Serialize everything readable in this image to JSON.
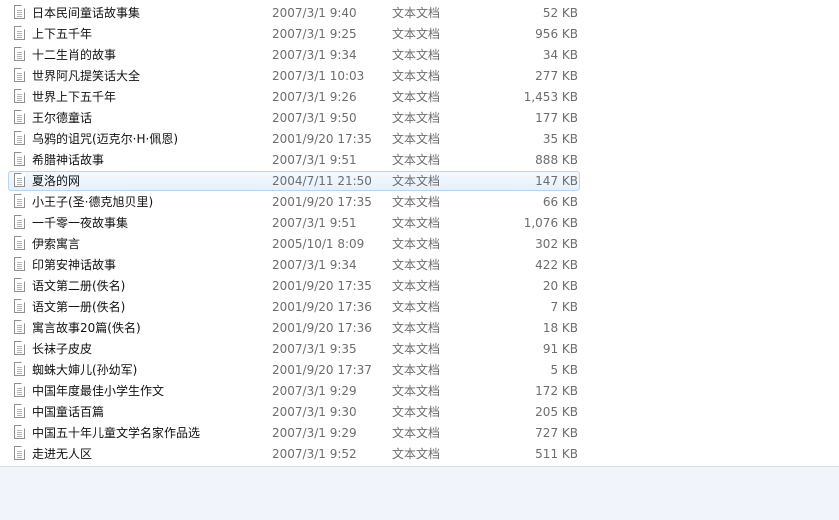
{
  "files": [
    {
      "name": "日本民间童话故事集",
      "date": "2007/3/1 9:40",
      "type": "文本文档",
      "size": "52 KB"
    },
    {
      "name": "上下五千年",
      "date": "2007/3/1 9:25",
      "type": "文本文档",
      "size": "956 KB"
    },
    {
      "name": "十二生肖的故事",
      "date": "2007/3/1 9:34",
      "type": "文本文档",
      "size": "34 KB"
    },
    {
      "name": "世界阿凡提笑话大全",
      "date": "2007/3/1 10:03",
      "type": "文本文档",
      "size": "277 KB"
    },
    {
      "name": "世界上下五千年",
      "date": "2007/3/1 9:26",
      "type": "文本文档",
      "size": "1,453 KB"
    },
    {
      "name": "王尔德童话",
      "date": "2007/3/1 9:50",
      "type": "文本文档",
      "size": "177 KB"
    },
    {
      "name": "乌鸦的诅咒(迈克尔·H·佩恩)",
      "date": "2001/9/20 17:35",
      "type": "文本文档",
      "size": "35 KB"
    },
    {
      "name": "希腊神话故事",
      "date": "2007/3/1 9:51",
      "type": "文本文档",
      "size": "888 KB"
    },
    {
      "name": "夏洛的网",
      "date": "2004/7/11 21:50",
      "type": "文本文档",
      "size": "147 KB",
      "selected": true
    },
    {
      "name": "小王子(圣·德克旭贝里)",
      "date": "2001/9/20 17:35",
      "type": "文本文档",
      "size": "66 KB"
    },
    {
      "name": "一千零一夜故事集",
      "date": "2007/3/1 9:51",
      "type": "文本文档",
      "size": "1,076 KB"
    },
    {
      "name": "伊索寓言",
      "date": "2005/10/1 8:09",
      "type": "文本文档",
      "size": "302 KB"
    },
    {
      "name": "印第安神话故事",
      "date": "2007/3/1 9:34",
      "type": "文本文档",
      "size": "422 KB"
    },
    {
      "name": "语文第二册(佚名)",
      "date": "2001/9/20 17:35",
      "type": "文本文档",
      "size": "20 KB"
    },
    {
      "name": "语文第一册(佚名)",
      "date": "2001/9/20 17:36",
      "type": "文本文档",
      "size": "7 KB"
    },
    {
      "name": "寓言故事20篇(佚名)",
      "date": "2001/9/20 17:36",
      "type": "文本文档",
      "size": "18 KB"
    },
    {
      "name": "长袜子皮皮",
      "date": "2007/3/1 9:35",
      "type": "文本文档",
      "size": "91 KB"
    },
    {
      "name": "蜘蛛大婶儿(孙幼军)",
      "date": "2001/9/20 17:37",
      "type": "文本文档",
      "size": "5 KB"
    },
    {
      "name": "中国年度最佳小学生作文",
      "date": "2007/3/1 9:29",
      "type": "文本文档",
      "size": "172 KB"
    },
    {
      "name": "中国童话百篇",
      "date": "2007/3/1 9:30",
      "type": "文本文档",
      "size": "205 KB"
    },
    {
      "name": "中国五十年儿童文学名家作品选",
      "date": "2007/3/1 9:29",
      "type": "文本文档",
      "size": "727 KB"
    },
    {
      "name": "走进无人区",
      "date": "2007/3/1 9:52",
      "type": "文本文档",
      "size": "511 KB"
    }
  ],
  "icon": "text-document-icon",
  "colors": {
    "selection_fill": "#e6f0fb",
    "selection_border": "#b8d6f1",
    "secondary_text": "#6d6d6d",
    "details_pane": "#f1f5fb"
  }
}
